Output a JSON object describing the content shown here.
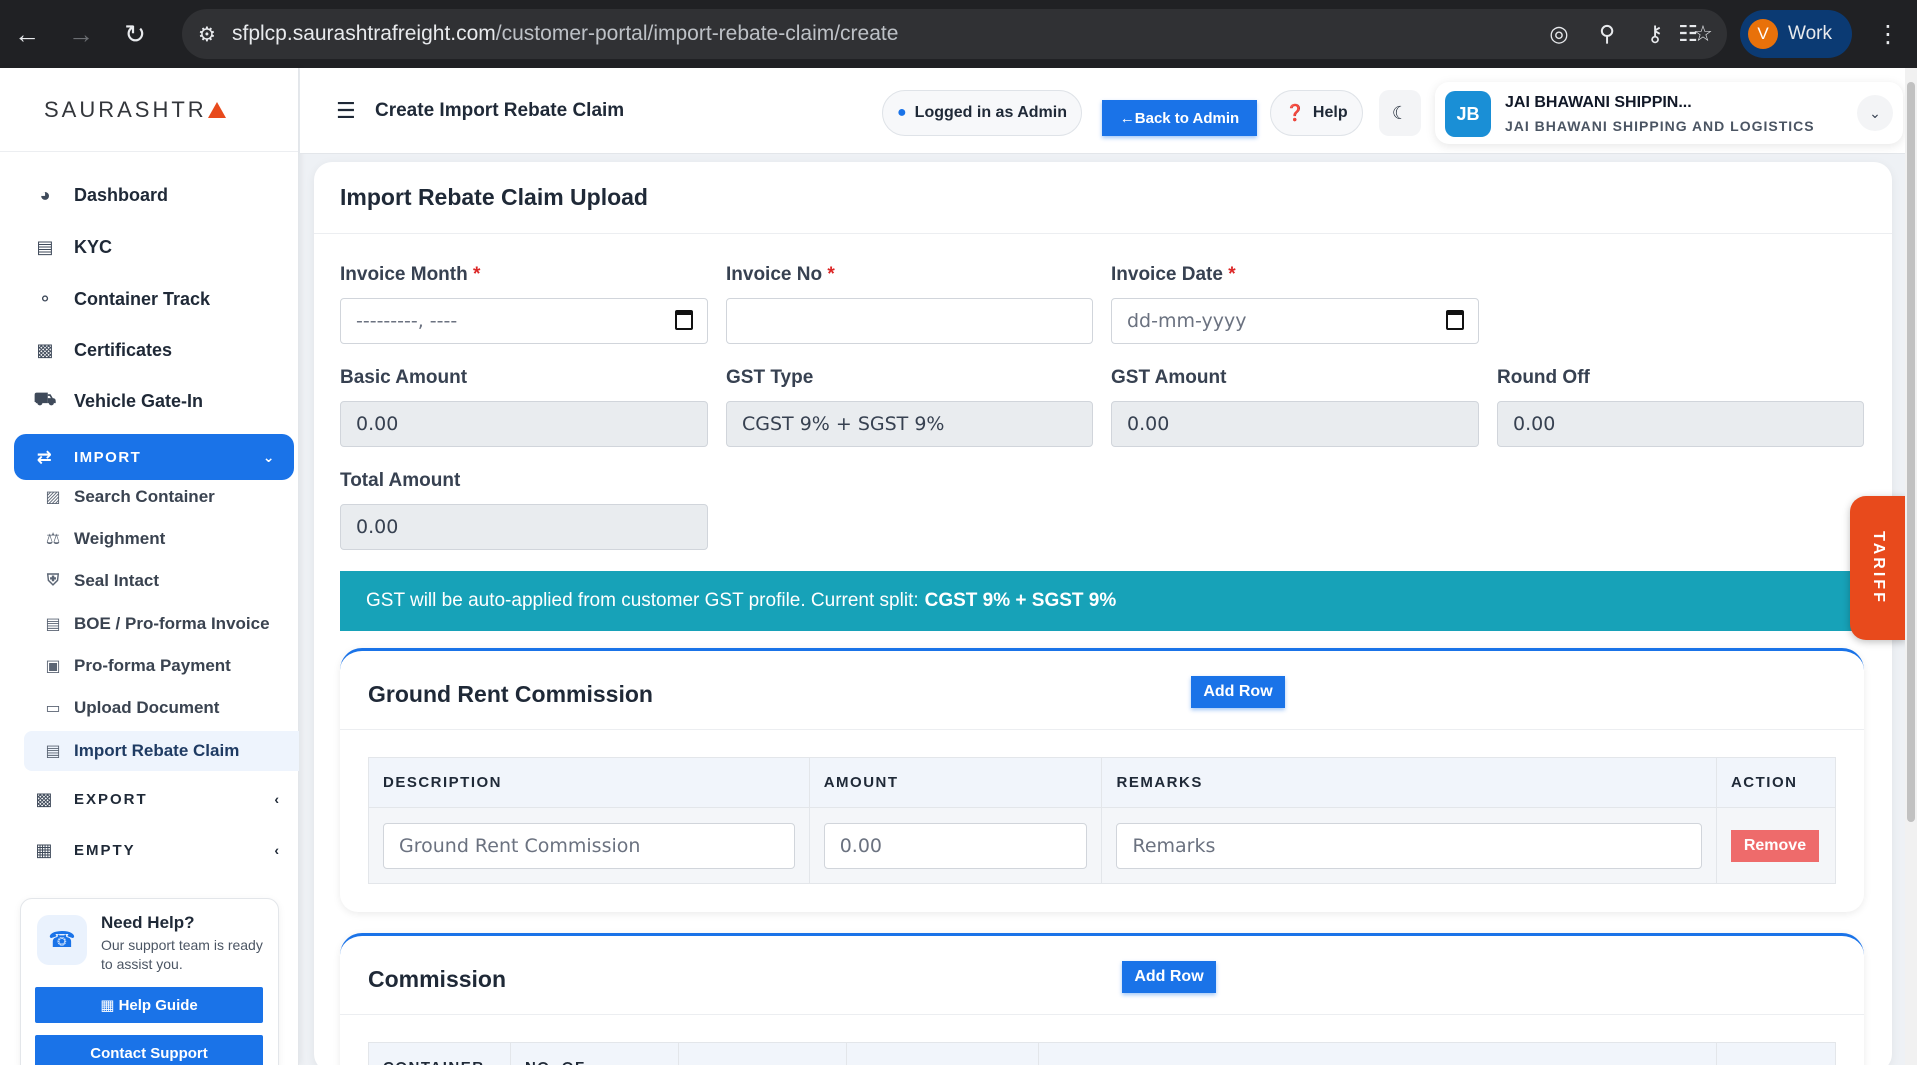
{
  "browser": {
    "url_host": "sfplcp.saurashtrafreight.com",
    "url_path": "/customer-portal/import-rebate-claim/create",
    "profile_initial": "V",
    "profile_label": "Work"
  },
  "brand": {
    "name": "SAURASHTR"
  },
  "sidebar": {
    "items": [
      {
        "label": "Dashboard",
        "icon": "dashboard-icon"
      },
      {
        "label": "KYC",
        "icon": "kyc-icon"
      },
      {
        "label": "Container Track",
        "icon": "track-icon"
      },
      {
        "label": "Certificates",
        "icon": "certificate-icon"
      },
      {
        "label": "Vehicle Gate-In",
        "icon": "truck-icon"
      }
    ],
    "import_group": {
      "label": "IMPORT"
    },
    "import_sub": [
      {
        "label": "Search Container"
      },
      {
        "label": "Weighment"
      },
      {
        "label": "Seal Intact"
      },
      {
        "label": "BOE / Pro-forma Invoice"
      },
      {
        "label": "Pro-forma Payment"
      },
      {
        "label": "Upload Document"
      },
      {
        "label": "Import Rebate Claim"
      }
    ],
    "export_group": {
      "label": "EXPORT"
    },
    "empty_group": {
      "label": "EMPTY"
    },
    "help": {
      "title": "Need Help?",
      "text": "Our support team is ready to assist you.",
      "guide_label": "Help Guide",
      "contact_label": "Contact Support"
    }
  },
  "header": {
    "page_title": "Create Import Rebate Claim",
    "logged_in_label": "Logged in as Admin",
    "back_label": "←Back to Admin",
    "help_label": "Help",
    "company_initials": "JB",
    "company_name": "JAI BHAWANI SHIPPIN...",
    "company_full": "JAI BHAWANI SHIPPING AND LOGISTICS"
  },
  "form": {
    "title": "Import Rebate Claim Upload",
    "invoice_month": {
      "label": "Invoice Month",
      "value": "---------, ----"
    },
    "invoice_no": {
      "label": "Invoice No",
      "value": ""
    },
    "invoice_date": {
      "label": "Invoice Date",
      "value": "dd-mm-yyyy"
    },
    "basic_amount": {
      "label": "Basic Amount",
      "value": "0.00"
    },
    "gst_type": {
      "label": "GST Type",
      "value": "CGST 9% + SGST 9%"
    },
    "gst_amount": {
      "label": "GST Amount",
      "value": "0.00"
    },
    "round_off": {
      "label": "Round Off",
      "value": "0.00"
    },
    "total_amount": {
      "label": "Total Amount",
      "value": "0.00"
    },
    "required_mark": "*"
  },
  "gst_info": {
    "text": "GST will be auto-applied from customer GST profile. Current split:",
    "split": "CGST 9% + SGST 9%"
  },
  "tariff_label": "TARIFF",
  "ground_rent": {
    "title": "Ground Rent Commission",
    "add_row_label": "Add Row",
    "columns": [
      "DESCRIPTION",
      "AMOUNT",
      "REMARKS",
      "ACTION"
    ],
    "row": {
      "description_placeholder": "Ground Rent Commission",
      "amount_placeholder": "0.00",
      "remarks_placeholder": "Remarks",
      "remove_label": "Remove"
    }
  },
  "commission": {
    "title": "Commission",
    "add_row_label": "Add Row",
    "columns": [
      "CONTAINER",
      "NO. OF"
    ]
  },
  "colors": {
    "primary": "#1a73e8",
    "info": "#17a2b8",
    "tariff": "#e84a1c",
    "remove": "#ee6b6b"
  }
}
